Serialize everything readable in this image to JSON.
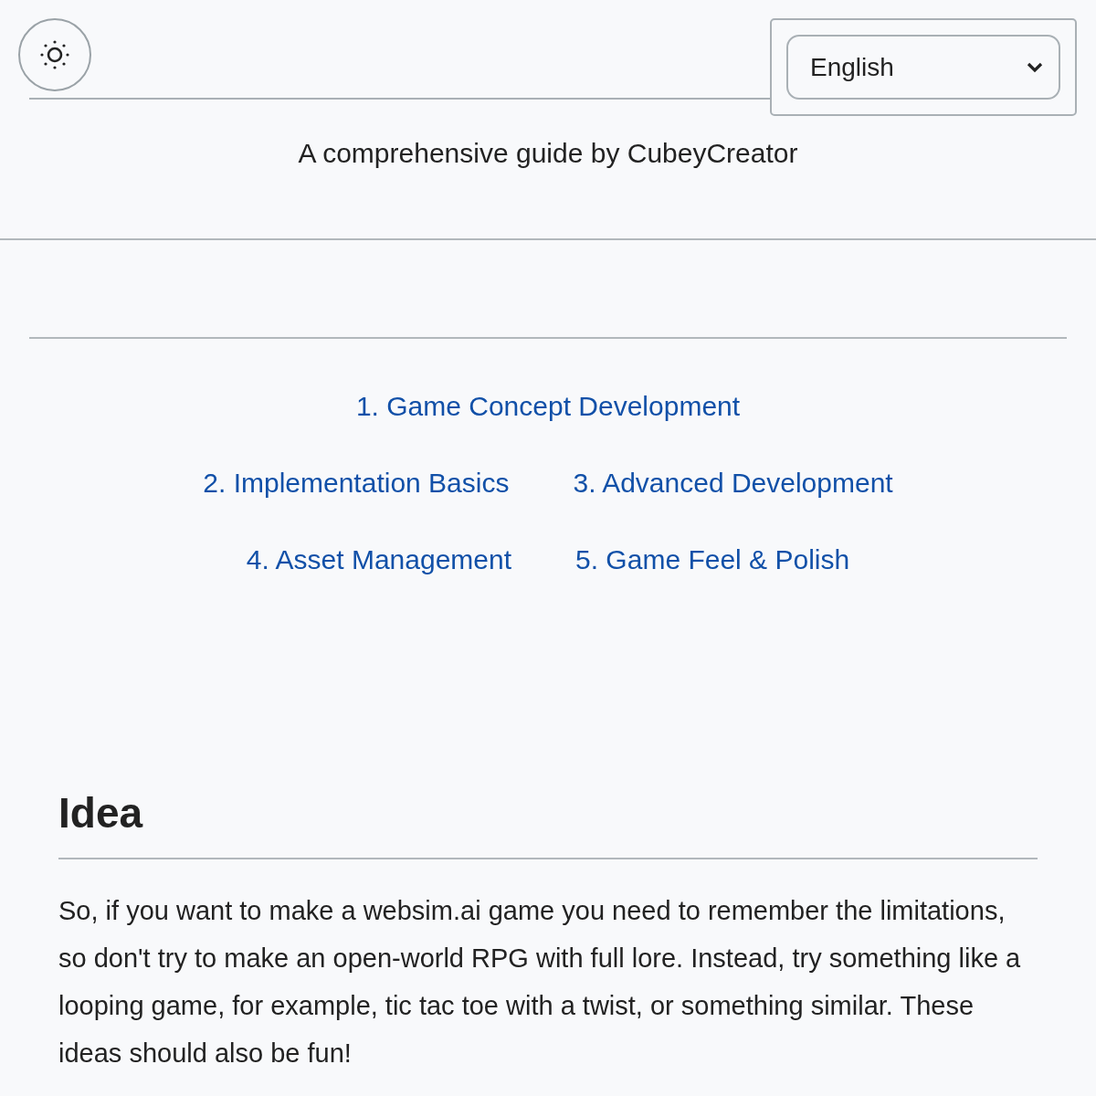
{
  "header": {
    "language": {
      "value": "English"
    },
    "subtitle": "A comprehensive guide by CubeyCreator"
  },
  "toc": [
    {
      "label": "1. Game Concept Development"
    },
    {
      "label": "2. Implementation Basics"
    },
    {
      "label": "3. Advanced Development"
    },
    {
      "label": "4. Asset Management"
    },
    {
      "label": "5. Game Feel & Polish"
    }
  ],
  "section": {
    "heading": "Idea",
    "paragraph": "So, if you want to make a websim.ai game you need to remember the limitations, so don't try to make an open-world RPG with full lore. Instead, try something like a looping game, for example, tic tac toe with a twist, or something similar. These ideas should also be fun!"
  }
}
